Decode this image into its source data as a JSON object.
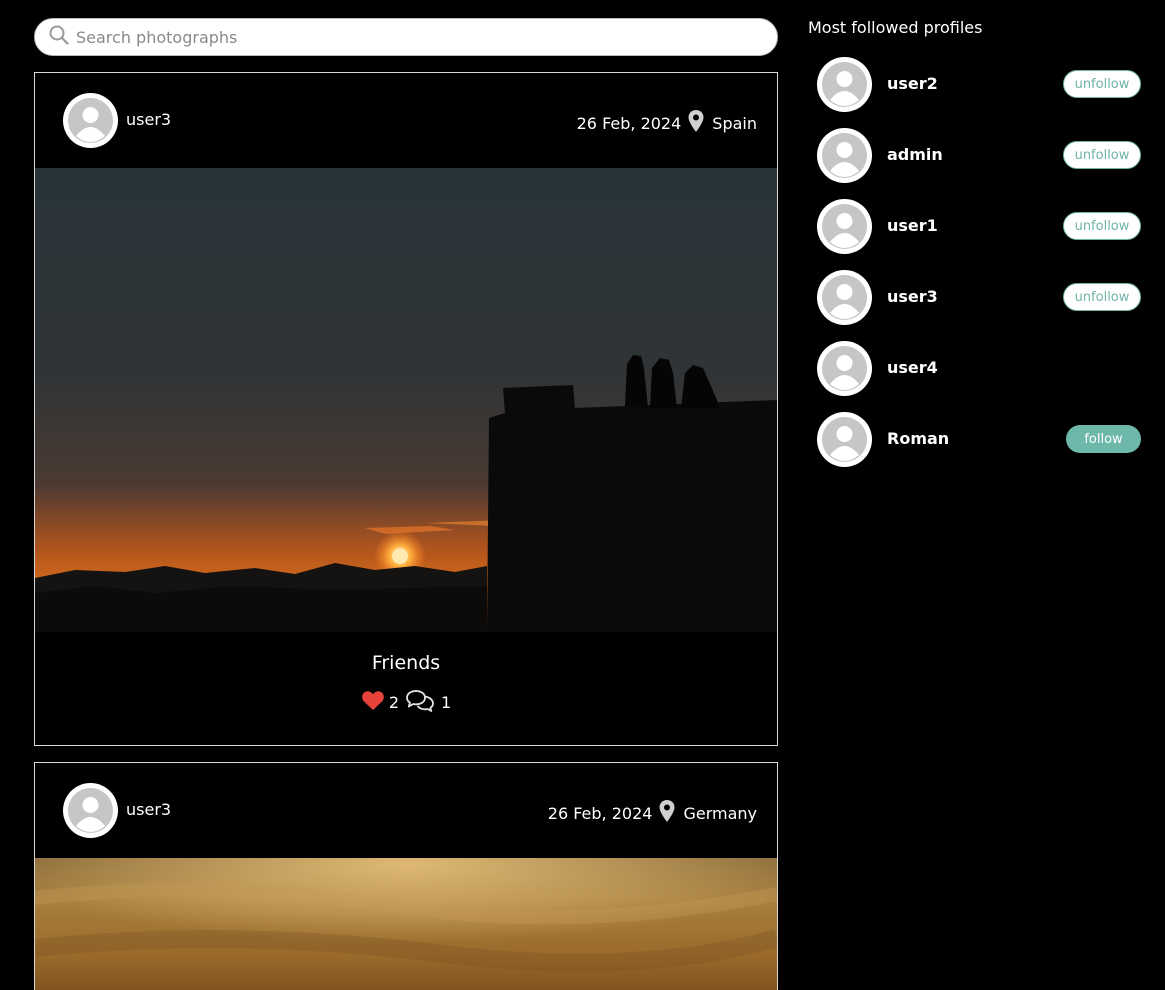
{
  "search": {
    "placeholder": "Search photographs",
    "icon": "search-icon"
  },
  "posts": [
    {
      "user": "user3",
      "date": "26 Feb, 2024",
      "location": "Spain",
      "caption": "Friends",
      "likes": "2",
      "comments": "1"
    },
    {
      "user": "user3",
      "date": "26 Feb, 2024",
      "location": "Germany"
    }
  ],
  "sidebar": {
    "title": "Most followed profiles",
    "profiles": [
      {
        "name": "user2",
        "button": "unfollow"
      },
      {
        "name": "admin",
        "button": "unfollow"
      },
      {
        "name": "user1",
        "button": "unfollow"
      },
      {
        "name": "user3",
        "button": "unfollow"
      },
      {
        "name": "user4"
      },
      {
        "name": "Roman",
        "button": "follow"
      }
    ]
  },
  "colors": {
    "accent": "#6db8ab",
    "like": "#e8433a",
    "background": "#000000"
  }
}
